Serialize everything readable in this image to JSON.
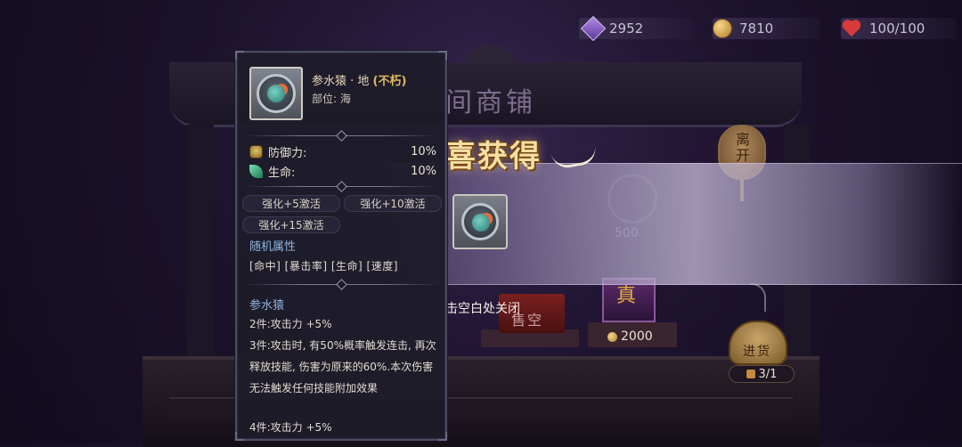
{
  "resources": {
    "gems": "2952",
    "gold": "7810",
    "health": "100/100",
    "gem_icon": "purple-gem-icon",
    "gold_icon": "gold-coin-icon",
    "health_icon": "heart-icon"
  },
  "shop": {
    "sign": "间商铺",
    "faded_price": "500",
    "item_price": "2000",
    "item_glyph": "真",
    "sold_out": "售空",
    "leave_label": "离开",
    "restock_label": "进货",
    "restock_count": "3/1"
  },
  "reward_popup": {
    "title": "喜获得",
    "close_hint": "击空白处关闭"
  },
  "tooltip": {
    "name": "参水猿 · 地",
    "quality": "(不朽)",
    "slot": "部位: 海",
    "stats": [
      {
        "label": "防御力:",
        "value": "10%"
      },
      {
        "label": "生命:",
        "value": "10%"
      }
    ],
    "enhance_tags": [
      "强化+5激活",
      "强化+10激活",
      "强化+15激活"
    ],
    "random_attr_title": "随机属性",
    "random_attrs": "[命中] [暴击率] [生命] [速度]",
    "set_name": "参水猿",
    "set_2": "2件:攻击力 +5%",
    "set_3": "3件:攻击时, 有50%概率触发连击, 再次释放技能, 伤害为原来的60%.本次伤害无法触发任何技能附加效果",
    "set_4": "4件:攻击力 +5%"
  },
  "colors": {
    "accent_gold": "#e0b866",
    "section_blue": "#8fb4e0",
    "panel_bg": "#1e1c2a",
    "title_gold": "#f6dfa2"
  }
}
